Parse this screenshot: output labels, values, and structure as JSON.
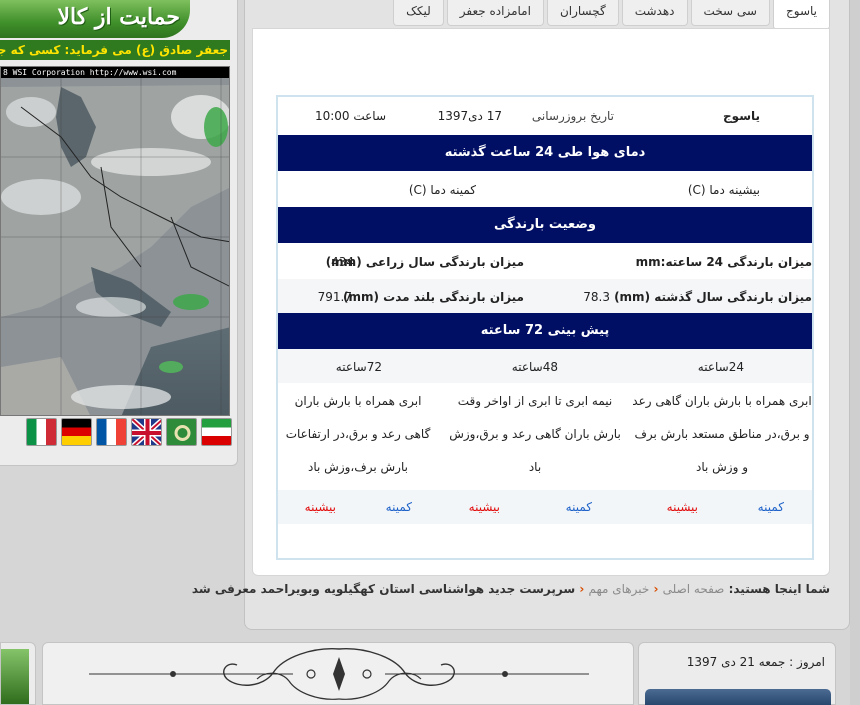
{
  "left": {
    "banner_text": "حمایت از کالا",
    "quote_text": "جعفر صادق (ع) می فرماید: کسی که جلوی",
    "map_caption": "8 WSI Corporation  http://www.wsi.com"
  },
  "tabs": [
    {
      "label": "یاسوج",
      "active": true
    },
    {
      "label": "سی سخت",
      "active": false
    },
    {
      "label": "دهدشت",
      "active": false
    },
    {
      "label": "گچساران",
      "active": false
    },
    {
      "label": "امامزاده جعفر",
      "active": false
    },
    {
      "label": "لیکک",
      "active": false
    }
  ],
  "station": {
    "city": "یاسوج",
    "update_label": "تاریخ بروزرسانی",
    "update_date": "17 دی1397",
    "time": "ساعت 10:00"
  },
  "temp_section": {
    "header": "دمای هوا طی 24 ساعت گذشته",
    "max_label": "بیشینه دما (C)",
    "min_label": "کمینه دما (C)"
  },
  "rain_section": {
    "header": "وضعیت بارندگی",
    "rain24_label": "میزان بارندگی 24 ساعته:mm",
    "agri_label": "میزان بارندگی سال زراعی (mm)",
    "agri_value": "434",
    "lastyear_label": "میزان بارندگی سال گذشته (mm)",
    "lastyear_value": "78.3",
    "longterm_label": "میزان بارندگی بلند مدت (mm)",
    "longterm_value": "791.7"
  },
  "forecast": {
    "header": "پیش بینی 72 ساعته",
    "periods": [
      "24ساعته",
      "48ساعته",
      "72ساعته"
    ],
    "texts": [
      "ابری همراه با بارش باران گاهی رعد و برق،در مناطق مستعد بارش برف و وزش باد",
      "نیمه ابری تا ابری از اواخر وقت بارش باران گاهی رعد و برق،وزش باد",
      "ابری همراه با بارش باران گاهی رعد و برق،در ارتفاعات بارش برف،وزش باد"
    ],
    "min_label": "کمینه",
    "max_label": "بیشینه"
  },
  "breadcrumb": {
    "prefix": "شما اینجا هستید:",
    "home": "صفحه اصلی",
    "news": "خبرهای مهم",
    "current": "سرپرست جدید هواشناسی استان کهگیلویه وبویراحمد معرفی شد"
  },
  "footer": {
    "today": "امروز : جمعه 21 دی 1397"
  },
  "colors": {
    "header_bg": "#000e63",
    "min_color": "#1e62c9",
    "max_color": "#e20e0e",
    "banner_green": "#3f8f2a"
  }
}
